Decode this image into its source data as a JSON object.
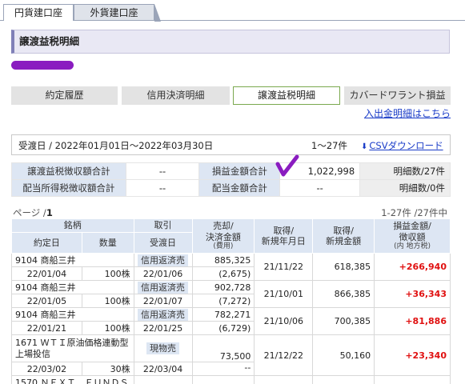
{
  "tabs": [
    {
      "label": "円貨建口座",
      "active": true
    },
    {
      "label": "外貨建口座",
      "active": false
    }
  ],
  "section_title": "譲渡益税明細",
  "subnav": [
    {
      "label": "約定履歴",
      "active": false
    },
    {
      "label": "信用決済明細",
      "active": false
    },
    {
      "label": "譲渡益税明細",
      "active": true
    },
    {
      "label": "カバードワラント損益",
      "active": false
    }
  ],
  "deposit_link": "入出金明細はこちら",
  "range": {
    "label": "受渡日 / 2022年01月01日〜2022年03月30日",
    "count": "1〜27件",
    "csv": "CSVダウンロード"
  },
  "summary": {
    "row1": {
      "tax_label": "譲渡益税徴収額合計",
      "tax_value": "--",
      "pl_label": "損益金額合計",
      "pl_value": "1,022,998",
      "side": "明細数/27件"
    },
    "row2": {
      "tax_label": "配当所得税徴収額合計",
      "tax_value": "--",
      "pl_label": "配当金額合計",
      "pl_value": "--",
      "side": "明細数/0件"
    }
  },
  "page": {
    "label": "ページ /",
    "number": "1"
  },
  "results": "1-27件 /27件中",
  "headers": {
    "security": "銘柄",
    "trade": "取引",
    "sale_l1": "売却/",
    "sale_l2": "決済金額",
    "sale_sub": "(費用)",
    "acq_date_l1": "取得/",
    "acq_date_l2": "新規年月日",
    "acq_amt_l1": "取得/",
    "acq_amt_l2": "新規金額",
    "pl_l1": "損益金額/",
    "pl_l2": "徴収額",
    "pl_sub": "(内 地方税)",
    "contract_date": "約定日",
    "quantity": "数量",
    "delivery_date": "受渡日"
  },
  "rows": [
    {
      "name": "9104 商船三井",
      "trade": "信用返済売",
      "sale": "885,325",
      "fee": "(2,675)",
      "contract": "22/01/04",
      "qty": "100株",
      "delivery": "22/01/06",
      "acq_date": "21/11/22",
      "acq_amt": "618,385",
      "pl": "+266,940"
    },
    {
      "name": "9104 商船三井",
      "trade": "信用返済売",
      "sale": "902,728",
      "fee": "(7,272)",
      "contract": "22/01/05",
      "qty": "100株",
      "delivery": "22/01/07",
      "acq_date": "21/10/01",
      "acq_amt": "866,385",
      "pl": "+36,343"
    },
    {
      "name": "9104 商船三井",
      "trade": "信用返済売",
      "sale": "782,271",
      "fee": "(6,729)",
      "contract": "22/01/21",
      "qty": "100株",
      "delivery": "22/01/25",
      "acq_date": "21/10/06",
      "acq_amt": "700,385",
      "pl": "+81,886"
    },
    {
      "name_l1": "1671 ＷＴＩ原油価格連動型",
      "name_l2": "上場投信",
      "trade": "現物売",
      "sale": "73,500",
      "fee": "--",
      "contract": "22/03/02",
      "qty": "30株",
      "delivery": "22/03/04",
      "acq_date": "21/12/22",
      "acq_amt": "50,160",
      "pl": "+23,340"
    }
  ],
  "partial_row": "1570 ＮＥＸＴ　ＦＵＮＤＳ",
  "colors": {
    "accent_header": "#8080b8",
    "table_header": "#dde6f3",
    "profit": "#e01010",
    "link": "#1a3cc8",
    "active_button_border": "#7aa84e"
  }
}
